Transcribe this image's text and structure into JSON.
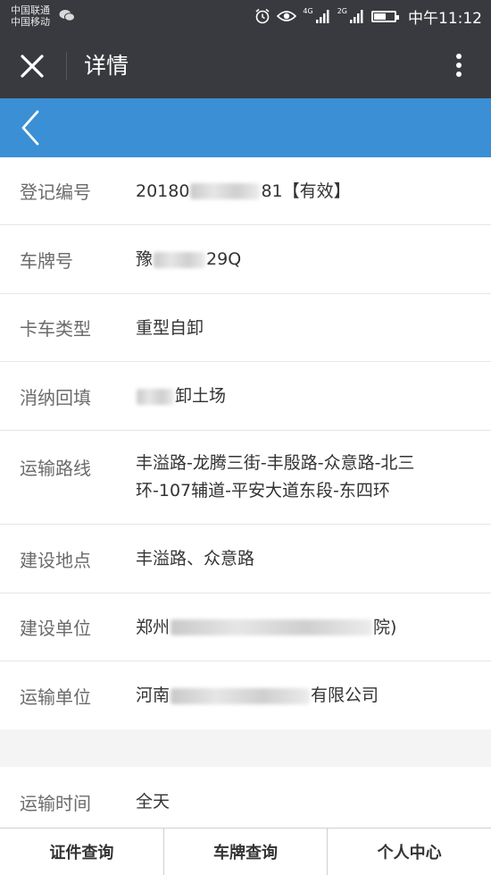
{
  "status_bar": {
    "carrier_1": "中国联通",
    "carrier_2": "中国移动",
    "net_1": "4G",
    "net_2": "2G",
    "time": "中午11:12"
  },
  "header": {
    "title": "详情"
  },
  "details": [
    {
      "label": "登记编号",
      "value_prefix": "20180",
      "value_suffix": "81【有效】"
    },
    {
      "label": "车牌号",
      "value_prefix": "豫",
      "value_suffix": "29Q"
    },
    {
      "label": "卡车类型",
      "value": "重型自卸"
    },
    {
      "label": "消纳回填",
      "value_prefix": "",
      "value_suffix": "卸土场"
    },
    {
      "label": "运输路线",
      "value": "丰溢路-龙腾三街-丰殷路-众意路-北三环-107辅道-平安大道东段-东四环"
    },
    {
      "label": "建设地点",
      "value": "丰溢路、众意路"
    },
    {
      "label": "建设单位",
      "value_prefix": "郑州",
      "value_suffix": "院)"
    },
    {
      "label": "运输单位",
      "value_prefix": "河南",
      "value_suffix": "有限公司"
    }
  ],
  "extra": [
    {
      "label": "运输时间",
      "value": "全天"
    }
  ],
  "tabs": [
    {
      "label": "证件查询"
    },
    {
      "label": "车牌查询"
    },
    {
      "label": "个人中心"
    }
  ]
}
